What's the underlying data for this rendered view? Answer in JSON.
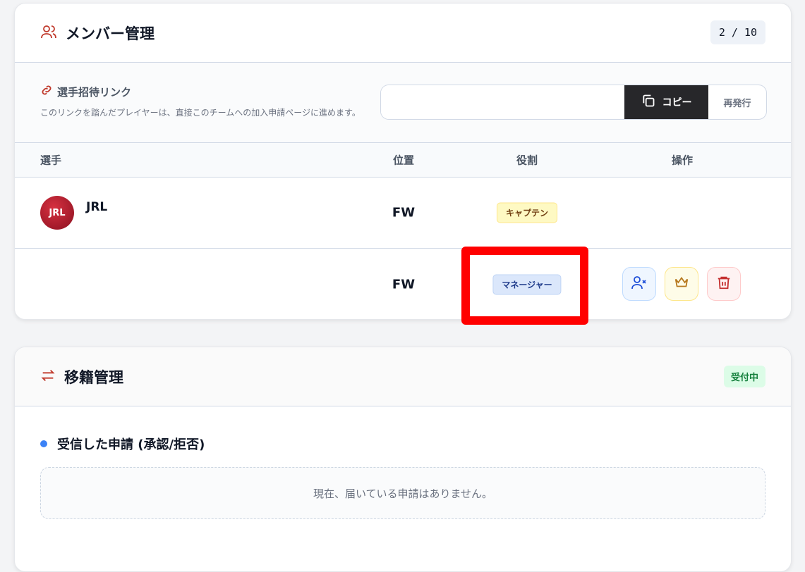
{
  "members": {
    "title": "メンバー管理",
    "count": "2 / 10",
    "invite": {
      "title": "選手招待リンク",
      "desc": "このリンクを踏んだプレイヤーは、直接このチームへの加入申請ページに進めます。",
      "link_value": "",
      "copy": "コピー",
      "reissue": "再発行"
    },
    "columns": {
      "player": "選手",
      "position": "位置",
      "role": "役割",
      "actions": "操作"
    },
    "rows": [
      {
        "name": "JRL",
        "avatar_text": "JRL",
        "position": "FW",
        "role": "キャプテン"
      },
      {
        "name": "",
        "position": "FW",
        "role": "マネージャー"
      }
    ]
  },
  "transfer": {
    "title": "移籍管理",
    "status": "受付中",
    "received_title": "受信した申請 (承認/拒否)",
    "empty": "現在、届いている申請はありません。"
  },
  "colors": {
    "accent": "#c0392b",
    "highlight": "#ff0000"
  }
}
